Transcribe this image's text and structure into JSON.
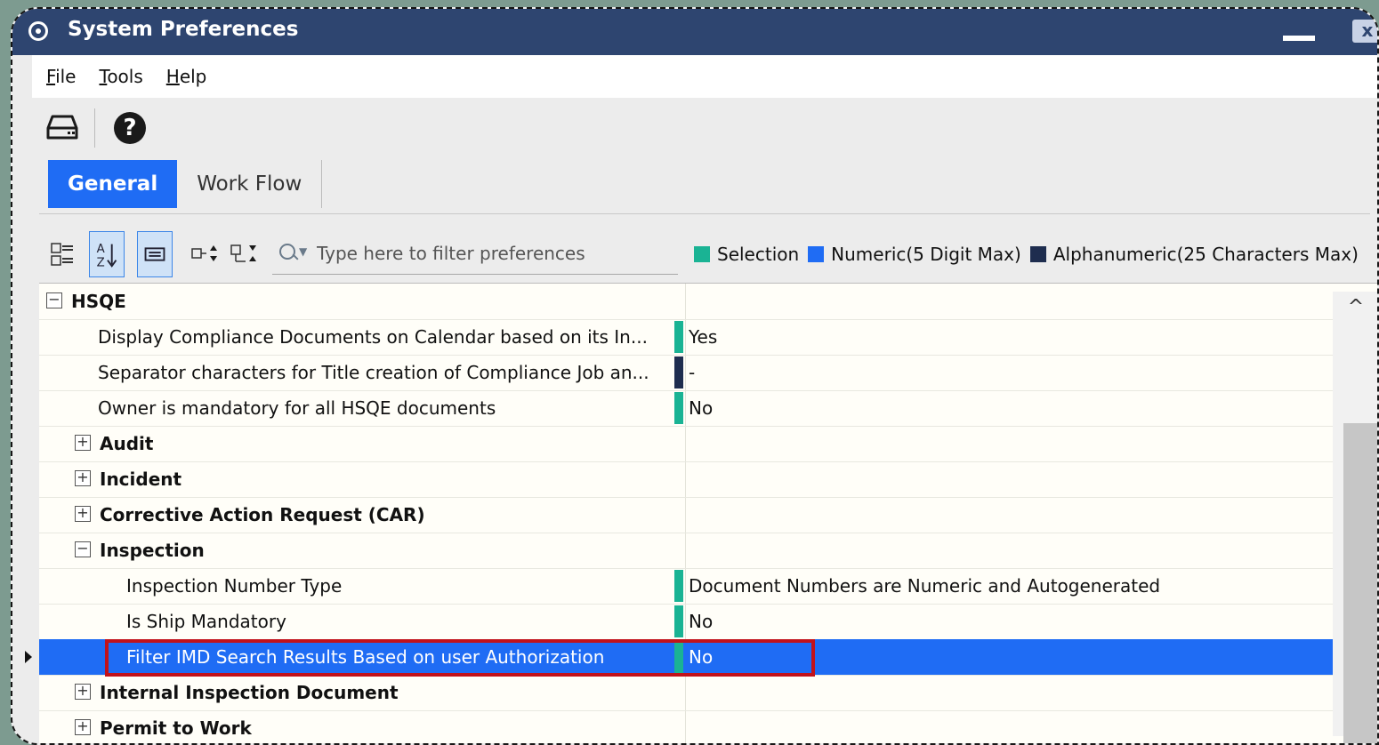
{
  "window": {
    "title": "System Preferences",
    "close_label": "x"
  },
  "menu": [
    {
      "mnemonic": "F",
      "rest": "ile"
    },
    {
      "mnemonic": "T",
      "rest": "ools"
    },
    {
      "mnemonic": "H",
      "rest": "elp"
    }
  ],
  "toolbar": {
    "help_glyph": "?"
  },
  "tabs": {
    "general": "General",
    "workflow": "Work Flow",
    "active": "General"
  },
  "filter": {
    "placeholder": "Type here to filter preferences"
  },
  "legend": [
    {
      "label": "Selection",
      "color": "#1ab394"
    },
    {
      "label": "Numeric(5 Digit Max)",
      "color": "#1f6cf4"
    },
    {
      "label": "Alphanumeric(25 Characters Max)",
      "color": "#1e2d4f"
    }
  ],
  "colors": {
    "accent": "#1f6cf4",
    "title_bar": "#2e4570",
    "highlight_box": "#c1121b"
  },
  "rows": [
    {
      "type": "group",
      "name": "HSQE",
      "expanded": true,
      "expander": "−"
    },
    {
      "type": "pref",
      "name": "Display Compliance Documents on Calendar based on its In...",
      "value": "Yes",
      "kind": "Selection"
    },
    {
      "type": "pref",
      "name": "Separator characters for Title creation of Compliance Job an...",
      "value": "-",
      "kind": "Alphanumeric"
    },
    {
      "type": "pref",
      "name": "Owner is mandatory for all HSQE documents",
      "value": "No",
      "kind": "Selection"
    },
    {
      "type": "group",
      "name": "Audit",
      "expanded": false,
      "expander": "+"
    },
    {
      "type": "group",
      "name": "Incident",
      "expanded": false,
      "expander": "+"
    },
    {
      "type": "group",
      "name": "Corrective Action Request (CAR)",
      "expanded": false,
      "expander": "+"
    },
    {
      "type": "group",
      "name": "Inspection",
      "expanded": true,
      "expander": "−"
    },
    {
      "type": "pref",
      "name": "Inspection Number Type",
      "value": "Document Numbers are Numeric and Autogenerated",
      "kind": "Selection"
    },
    {
      "type": "pref",
      "name": "Is Ship Mandatory",
      "value": "No",
      "kind": "Selection"
    },
    {
      "type": "pref",
      "name": "Filter IMD Search Results Based on user Authorization",
      "value": "No",
      "kind": "Selection",
      "selected": true
    },
    {
      "type": "group",
      "name": "Internal Inspection Document",
      "expanded": false,
      "expander": "+"
    },
    {
      "type": "group",
      "name": "Permit to Work",
      "expanded": false,
      "expander": "+"
    }
  ]
}
